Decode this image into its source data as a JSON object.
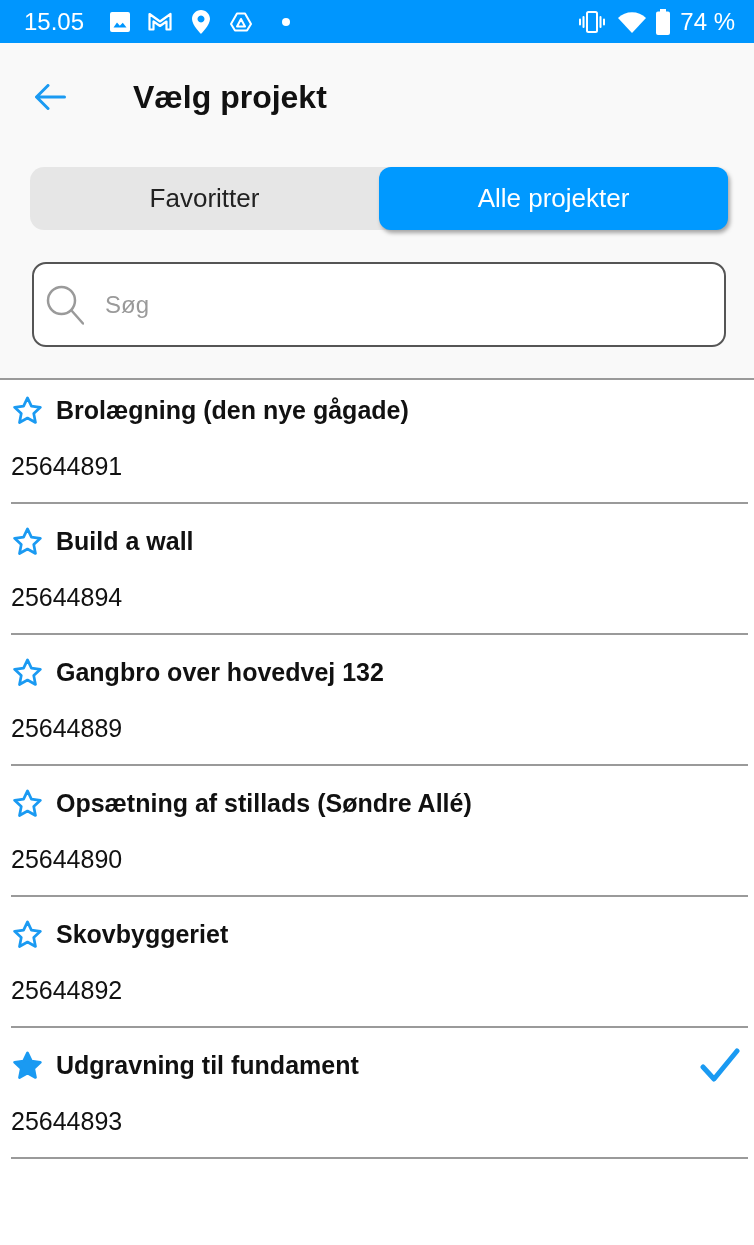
{
  "status_bar": {
    "time": "15.05",
    "battery": "74 %"
  },
  "header": {
    "title": "Vælg projekt"
  },
  "tabs": [
    {
      "label": "Favoritter",
      "selected": false
    },
    {
      "label": "Alle projekter",
      "selected": true
    }
  ],
  "search": {
    "placeholder": "Søg"
  },
  "projects": [
    {
      "name": "Brolægning (den nye gågade)",
      "number": "25644891",
      "favorite": false,
      "selected": false
    },
    {
      "name": "Build a wall",
      "number": "25644894",
      "favorite": false,
      "selected": false
    },
    {
      "name": "Gangbro over hovedvej 132",
      "number": "25644889",
      "favorite": false,
      "selected": false
    },
    {
      "name": "Opsætning af stillads (Søndre Allé)",
      "number": "25644890",
      "favorite": false,
      "selected": false
    },
    {
      "name": "Skovbyggeriet",
      "number": "25644892",
      "favorite": false,
      "selected": false
    },
    {
      "name": "Udgravning til fundament",
      "number": "25644893",
      "favorite": true,
      "selected": true
    }
  ]
}
